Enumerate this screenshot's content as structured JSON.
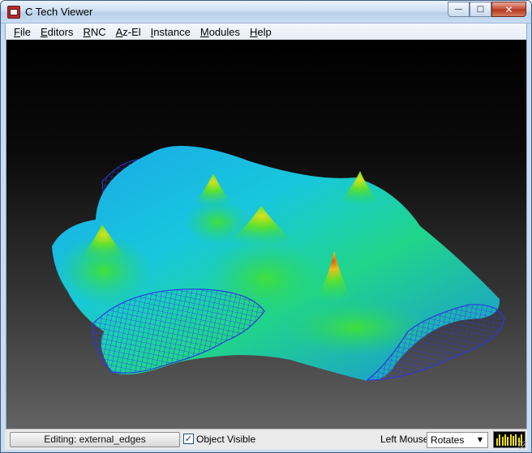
{
  "window": {
    "title": "C Tech Viewer",
    "icon": "ctech-app-icon",
    "icon_text": "Tech",
    "controls": {
      "minimize": "—",
      "maximize": "□",
      "close": "✕"
    }
  },
  "menu": {
    "items": [
      {
        "accel": "F",
        "rest": "ile"
      },
      {
        "accel": "E",
        "rest": "ditors"
      },
      {
        "accel": "R",
        "rest": "NC"
      },
      {
        "accel": "A",
        "rest": "z-El"
      },
      {
        "accel": "I",
        "rest": "nstance"
      },
      {
        "accel": "M",
        "rest": "odules"
      },
      {
        "accel": "H",
        "rest": "elp"
      }
    ]
  },
  "viewport": {
    "content": "3d-surface-plot",
    "background_top": "#000000",
    "background_bottom": "#636363",
    "colormap": [
      "#1a5fd6",
      "#16c4e6",
      "#1de04a",
      "#c6d820",
      "#e36a0a"
    ],
    "mesh_color": "#2233dd"
  },
  "status": {
    "editing_label": "Editing: external_edges",
    "object_visible_label": "Object Visible",
    "object_visible_checked": true,
    "left_mouse_label": "Left Mouse",
    "left_mouse_mode": "Rotates",
    "meter_levels": [
      0.6,
      0.95,
      0.75,
      0.9,
      0.7,
      0.95,
      0.8,
      0.9,
      0.65,
      0.95
    ]
  }
}
